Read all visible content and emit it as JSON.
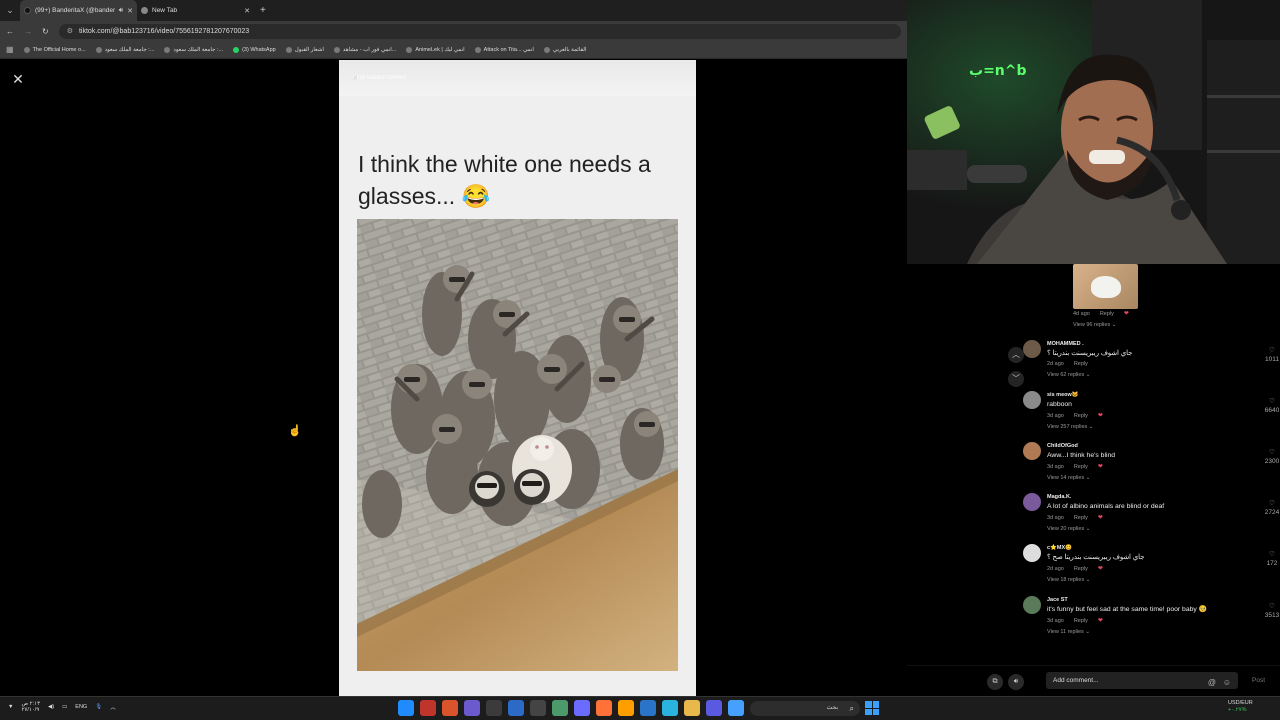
{
  "browser": {
    "tabs": [
      {
        "label": "(99+) BanderitaX (@bander...",
        "active": true
      },
      {
        "label": "New Tab",
        "active": false
      }
    ],
    "url": "tiktok.com/@bab123716/video/7556192781207670023",
    "bookmarks": [
      "The Official Home o...",
      "جامعة الملك سعود :...",
      "جامعة الملك سعود :...",
      "(3) WhatsApp",
      "اشعار القبول",
      "انمي فور اب - مشاهد...",
      "AnimeLek | انمي ليك",
      "Attack on Tita... انمي",
      "القائمة بالعربي"
    ]
  },
  "video": {
    "search_placeholder": "Find related content",
    "caption": "I think the white one needs a glasses... 😂"
  },
  "comments_panel": {
    "top_meta": {
      "time": "4d ago",
      "reply": "Reply",
      "replies": "View 96 replies"
    },
    "comments": [
      {
        "name": "MOHAMMED .",
        "text": "جاي اشوف ريبريسنت بندريتا ؟",
        "time": "2d ago",
        "reply": "Reply",
        "replies": "View 62 replies",
        "likes": "1011",
        "avatar_color": "#6d5a48"
      },
      {
        "name": "sis meow🐱",
        "text": "rabboon",
        "time": "3d ago",
        "reply": "Reply",
        "replies": "View 257 replies",
        "likes": "6640",
        "avatar_color": "#8a8a8a"
      },
      {
        "name": "ChildOfGod",
        "text": "Aww...I think he's blind",
        "time": "3d ago",
        "reply": "Reply",
        "replies": "View 14 replies",
        "likes": "2300",
        "avatar_color": "#b07a55"
      },
      {
        "name": "Magda.K.",
        "text": "A lot of albino animals are blind or deaf",
        "time": "3d ago",
        "reply": "Reply",
        "replies": "View 20 replies",
        "likes": "2724",
        "avatar_color": "#7a5a9a"
      },
      {
        "name": "c⭐MX😊",
        "text": "جاي اشوف ريبريسنت بندريتا صح ؟",
        "time": "2d ago",
        "reply": "Reply",
        "replies": "View 18 replies",
        "likes": "172",
        "avatar_color": "#dddddd"
      },
      {
        "name": "Jace ST",
        "text": "it's funny but feel sad at the same time! poor baby 🥺",
        "time": "3d ago",
        "reply": "Reply",
        "replies": "View 11 replies",
        "likes": "3513",
        "avatar_color": "#5a7a5a"
      }
    ],
    "add_comment_placeholder": "Add comment...",
    "post_label": "Post"
  },
  "taskbar": {
    "time": "٢:١٣ ص",
    "date": "٢٧/١٠/٩",
    "lang": "ENG",
    "search_text": "بحث",
    "currency": "USD/EUR",
    "currency_change": "+٠.٢٧%",
    "icon_colors": [
      "#1f8bff",
      "#c0352b",
      "#d9532c",
      "#6b5acd",
      "#1e1e1e",
      "#2c6ac8",
      "#3b3b3b",
      "#4c9a6b",
      "#6b6bff",
      "#ff7139",
      "#ff9e00",
      "#2a74c9",
      "#2bb3e0",
      "#e8b94a",
      "#5a5ae0",
      "#46a0ff",
      "#0a7ff0"
    ]
  }
}
